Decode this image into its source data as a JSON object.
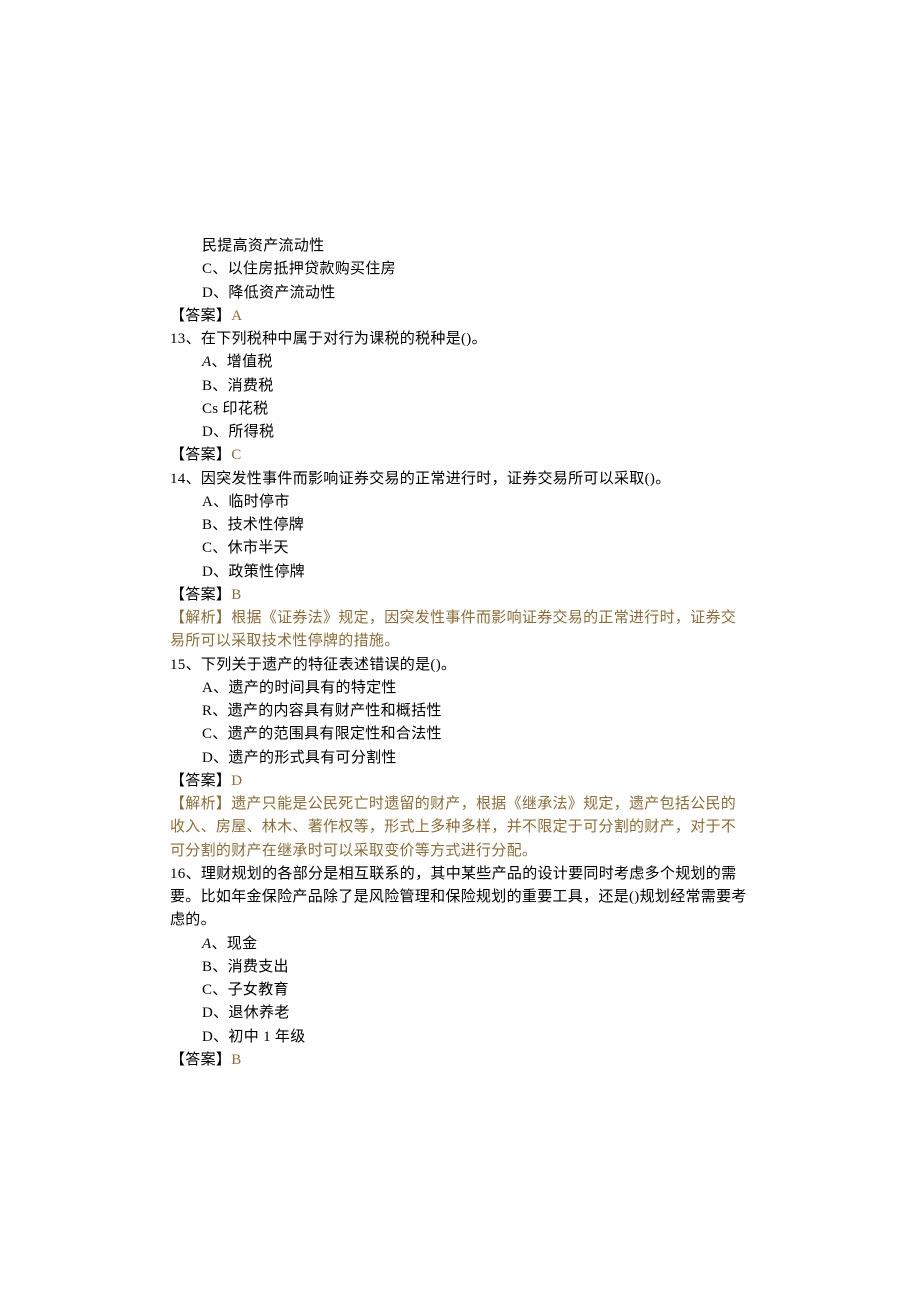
{
  "colors": {
    "accent": "#8A6D3B"
  },
  "q12": {
    "tail": "民提高资产流动性",
    "C": "C、以住房抵押贷款购买住房",
    "D": "D、降低资产流动性",
    "ans_label": "【答案】",
    "ans": "A"
  },
  "q13": {
    "stem": "13、在下列税种中属于对行为课税的税种是()。",
    "A_prefix": "A",
    "A_rest": "、增值税",
    "B": "B、消费税",
    "C": "Cs 印花税",
    "D": "D、所得税",
    "ans_label": "【答案】",
    "ans": "C"
  },
  "q14": {
    "stem": "14、因突发性事件而影响证券交易的正常进行时，证券交易所可以采取()。",
    "A": "A、临时停市",
    "B": "B、技术性停牌",
    "C": "C、休市半天",
    "D": "D、政策性停牌",
    "ans_label": "【答案】",
    "ans": "B",
    "exp_label": "【解析】",
    "exp": "根据《证券法》规定，因突发性事件而影响证券交易的正常进行时，证券交易所可以采取技术性停牌的措施。"
  },
  "q15": {
    "stem": "15、下列关于遗产的特征表述错误的是()。",
    "A": "A、遗产的时间具有的特定性",
    "B": "R、遗产的内容具有财产性和概括性",
    "C": "C、遗产的范围具有限定性和合法性",
    "D": "D、遗产的形式具有可分割性",
    "ans_label": "【答案】",
    "ans": "D",
    "exp_label": "【解析】",
    "exp": "遗产只能是公民死亡时遗留的财产，根据《继承法》规定，遗产包括公民的收入、房屋、林木、著作权等，形式上多种多样，并不限定于可分割的财产，对于不可分割的财产在继承时可以采取变价等方式进行分配。"
  },
  "q16": {
    "stem": "16、理财规划的各部分是相互联系的，其中某些产品的设计要同时考虑多个规划的需要。比如年金保险产品除了是风险管理和保险规划的重要工具，还是()规划经常需要考虑的。",
    "A_prefix": "A",
    "A_rest": "、现金",
    "B": "B、消费支出",
    "C": "C、子女教育",
    "D": "D、退休养老",
    "E": "D、初中 1 年级",
    "ans_label": "【答案】",
    "ans": "B"
  }
}
